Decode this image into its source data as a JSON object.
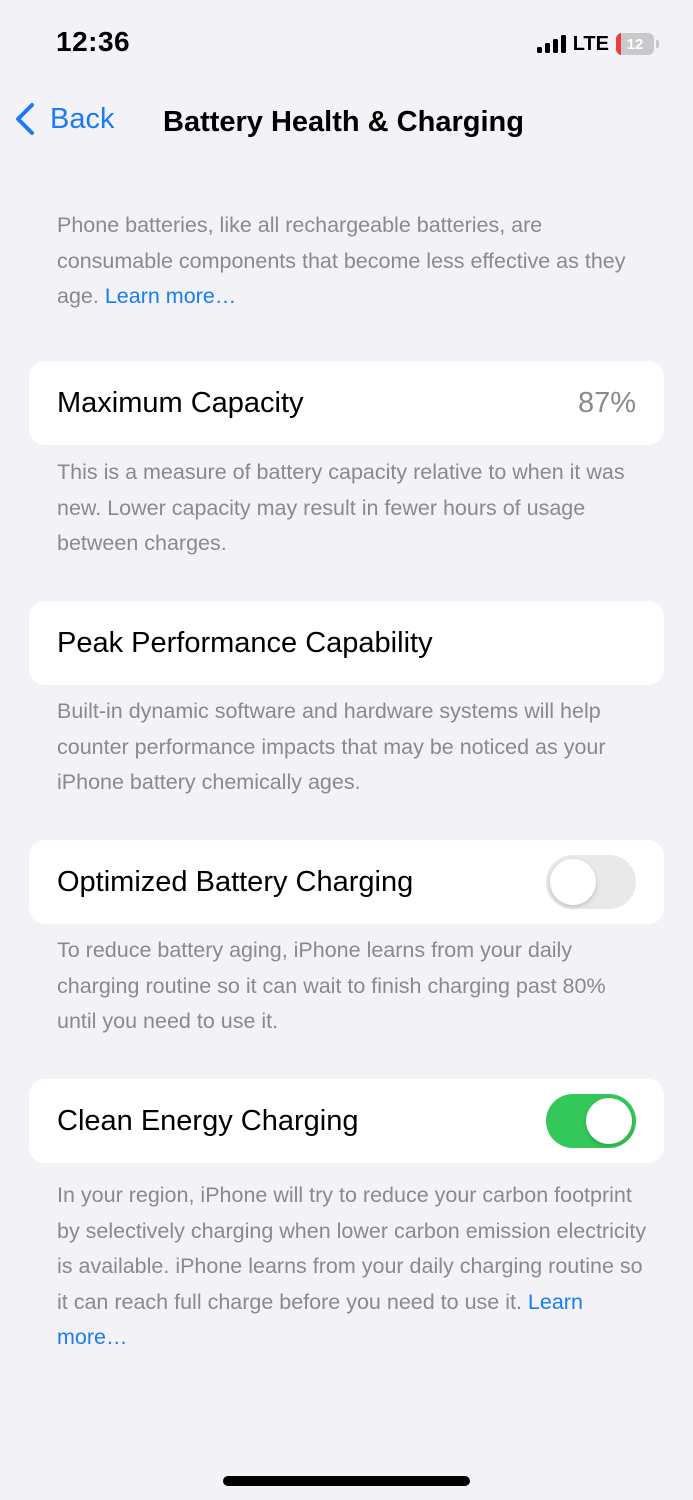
{
  "status_bar": {
    "time": "12:36",
    "network": "LTE",
    "battery_level": "12",
    "battery_fraction": 0.12,
    "signal_bars": 4
  },
  "nav": {
    "back_label": "Back",
    "title": "Battery Health & Charging"
  },
  "intro": {
    "text": "Phone batteries, like all rechargeable batteries, are consumable components that become less effective as they age. ",
    "link": "Learn more…"
  },
  "maximum_capacity": {
    "label": "Maximum Capacity",
    "value": "87%",
    "description": "This is a measure of battery capacity relative to when it was new. Lower capacity may result in fewer hours of usage between charges."
  },
  "peak_performance": {
    "label": "Peak Performance Capability",
    "description": "Built-in dynamic software and hardware systems will help counter performance impacts that may be noticed as your iPhone battery chemically ages."
  },
  "optimized_charging": {
    "label": "Optimized Battery Charging",
    "enabled": false,
    "description": "To reduce battery aging, iPhone learns from your daily charging routine so it can wait to finish charging past 80% until you need to use it."
  },
  "clean_energy": {
    "label": "Clean Energy Charging",
    "enabled": true,
    "description": "In your region, iPhone will try to reduce your carbon footprint by selectively charging when lower carbon emission electricity is available. iPhone learns from your daily charging routine so it can reach full charge before you need to use it. ",
    "link": "Learn more…"
  },
  "colors": {
    "accent": "#1a7cf5",
    "toggle_on": "#34c759",
    "toggle_off": "#e9e9ea",
    "battery_low": "#e9403d",
    "background": "#f2f2f7"
  }
}
